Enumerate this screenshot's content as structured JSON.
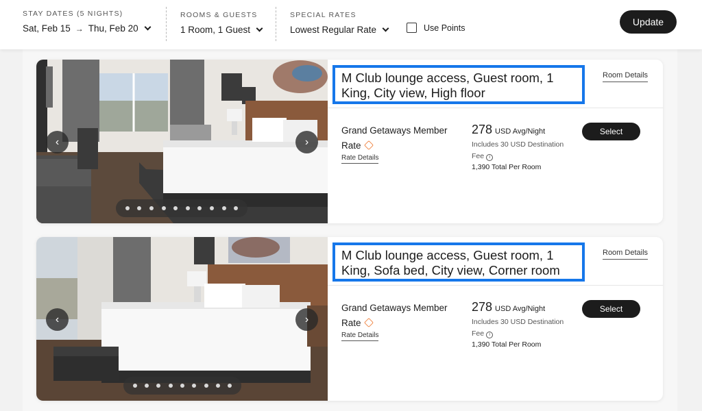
{
  "header": {
    "stay_dates": {
      "label": "STAY DATES (5 NIGHTS)",
      "check_in": "Sat, Feb 15",
      "arrow": "→",
      "check_out": "Thu, Feb 20"
    },
    "rooms_guests": {
      "label": "ROOMS & GUESTS",
      "value": "1 Room, 1 Guest"
    },
    "special_rates": {
      "label": "SPECIAL RATES",
      "value": "Lowest Regular Rate"
    },
    "use_points": {
      "label": "Use Points",
      "checked": false
    },
    "update_label": "Update"
  },
  "rooms": [
    {
      "title": "M Club lounge access, Guest room, 1 King, City view, High floor",
      "room_details_label": "Room Details",
      "rate_name": "Grand Getaways Member Rate",
      "rate_details_label": "Rate Details",
      "price": "278",
      "price_unit": "USD Avg/Night",
      "fee_note": "Includes 30 USD Destination Fee",
      "total": "1,390 Total Per Room",
      "select_label": "Select",
      "photo_count": 10
    },
    {
      "title": "M Club lounge access, Guest room, 1 King, Sofa bed, City view, Corner room",
      "room_details_label": "Room Details",
      "rate_name": "Grand Getaways Member Rate",
      "rate_details_label": "Rate Details",
      "price": "278",
      "price_unit": "USD Avg/Night",
      "fee_note": "Includes 30 USD Destination Fee",
      "total": "1,390 Total Per Room",
      "select_label": "Select",
      "photo_count": 9
    }
  ],
  "colors": {
    "highlight": "#1677ea",
    "button": "#1c1c1c",
    "tag": "#f08a4b"
  }
}
